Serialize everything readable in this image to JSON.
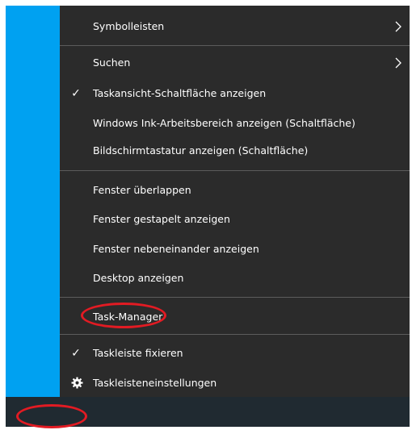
{
  "menu": {
    "items": [
      {
        "label": "Symbolleisten",
        "checked": false,
        "submenu": true
      },
      {
        "label": "Suchen",
        "checked": false,
        "submenu": true
      },
      {
        "label": "Taskansicht-Schaltfläche anzeigen",
        "checked": true,
        "submenu": false
      },
      {
        "label": "Windows Ink-Arbeitsbereich anzeigen (Schaltfläche)",
        "checked": false,
        "submenu": false
      },
      {
        "label": "Bildschirmtastatur anzeigen (Schaltfläche)",
        "checked": false,
        "submenu": false
      },
      {
        "label": "Fenster überlappen",
        "checked": false,
        "submenu": false
      },
      {
        "label": "Fenster gestapelt anzeigen",
        "checked": false,
        "submenu": false
      },
      {
        "label": "Fenster nebeneinander anzeigen",
        "checked": false,
        "submenu": false
      },
      {
        "label": "Desktop anzeigen",
        "checked": false,
        "submenu": false
      },
      {
        "label": "Task-Manager",
        "checked": false,
        "submenu": false,
        "highlighted": true
      },
      {
        "label": "Taskleiste fixieren",
        "checked": true,
        "submenu": false
      },
      {
        "label": "Taskleisteneinstellungen",
        "checked": false,
        "submenu": false,
        "icon": "gear-icon"
      }
    ],
    "check_glyph": "✓"
  },
  "colors": {
    "menu_bg": "#2b2b2b",
    "desktop_bg": "#00a1f1",
    "taskbar_bg": "#202a31",
    "highlight_ring": "#e21b23",
    "separator": "#5c5c5c"
  }
}
